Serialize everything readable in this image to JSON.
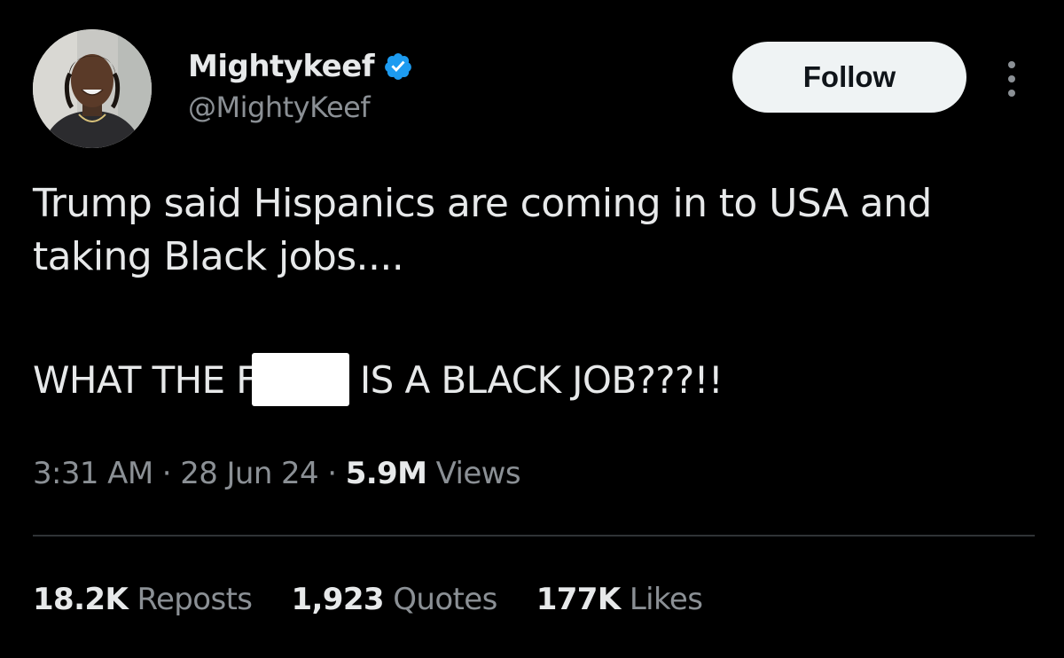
{
  "author": {
    "display_name": "Mightykeef",
    "handle": "@MightyKeef",
    "verified_icon": "verified-badge-icon",
    "avatar_icon": "profile-photo"
  },
  "actions": {
    "follow_label": "Follow",
    "more_icon": "more-vertical-icon"
  },
  "tweet": {
    "text": "Trump said Hispanics are coming in to USA and\ntaking Black jobs....",
    "shout_prefix": "WHAT THE F",
    "shout_suffix": "IS A BLACK JOB???!!"
  },
  "meta": {
    "time": "3:31 AM",
    "separator": " · ",
    "date": "28 Jun 24",
    "views_count": "5.9M",
    "views_label": "Views"
  },
  "stats": [
    {
      "value": "18.2K",
      "label": "Reposts"
    },
    {
      "value": "1,923",
      "label": "Quotes"
    },
    {
      "value": "177K",
      "label": "Likes"
    }
  ],
  "colors": {
    "background": "#000000",
    "primary_text": "#e7e9ea",
    "secondary_text": "#8b9095",
    "verified_blue": "#1d9bf0",
    "button_bg": "#eff3f4",
    "divider": "#2f3336"
  }
}
